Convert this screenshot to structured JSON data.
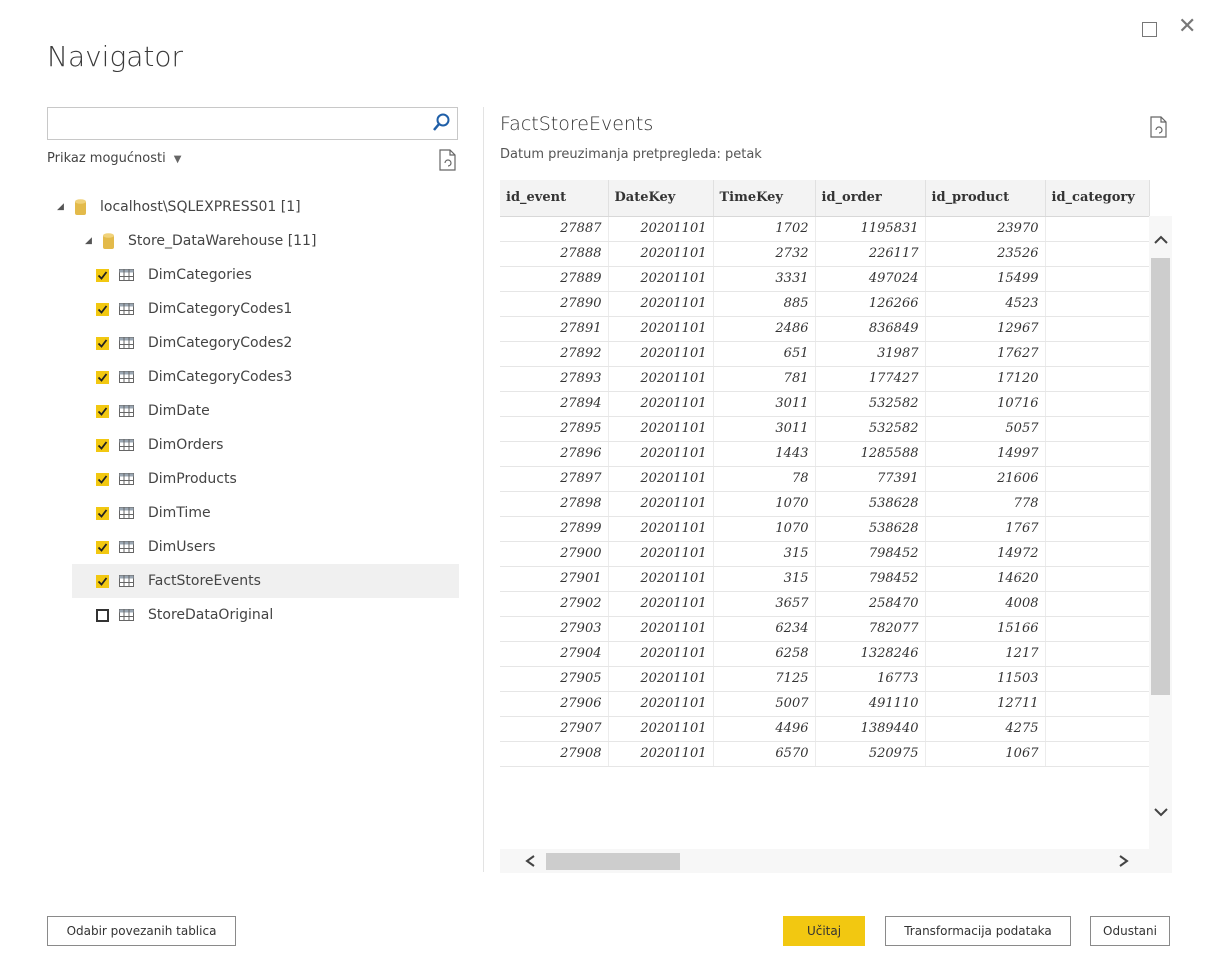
{
  "dialog": {
    "title": "Navigator"
  },
  "search": {
    "placeholder": ""
  },
  "left": {
    "display_options_label": "Prikaz mogućnosti",
    "server": "localhost\\SQLEXPRESS01 [1]",
    "database": "Store_DataWarehouse [11]",
    "items": [
      {
        "label": "DimCategories",
        "checked": true
      },
      {
        "label": "DimCategoryCodes1",
        "checked": true
      },
      {
        "label": "DimCategoryCodes2",
        "checked": true
      },
      {
        "label": "DimCategoryCodes3",
        "checked": true
      },
      {
        "label": "DimDate",
        "checked": true
      },
      {
        "label": "DimOrders",
        "checked": true
      },
      {
        "label": "DimProducts",
        "checked": true
      },
      {
        "label": "DimTime",
        "checked": true
      },
      {
        "label": "DimUsers",
        "checked": true
      },
      {
        "label": "FactStoreEvents",
        "checked": true,
        "selected": true
      },
      {
        "label": "StoreDataOriginal",
        "checked": false
      }
    ]
  },
  "preview": {
    "title": "FactStoreEvents",
    "subtitle": "Datum preuzimanja pretpregleda: petak",
    "columns": [
      "id_event",
      "DateKey",
      "TimeKey",
      "id_order",
      "id_product",
      "id_category"
    ],
    "rows": [
      [
        "27887",
        "20201101",
        "1702",
        "1195831",
        "23970",
        ""
      ],
      [
        "27888",
        "20201101",
        "2732",
        "226117",
        "23526",
        ""
      ],
      [
        "27889",
        "20201101",
        "3331",
        "497024",
        "15499",
        ""
      ],
      [
        "27890",
        "20201101",
        "885",
        "126266",
        "4523",
        ""
      ],
      [
        "27891",
        "20201101",
        "2486",
        "836849",
        "12967",
        ""
      ],
      [
        "27892",
        "20201101",
        "651",
        "31987",
        "17627",
        ""
      ],
      [
        "27893",
        "20201101",
        "781",
        "177427",
        "17120",
        ""
      ],
      [
        "27894",
        "20201101",
        "3011",
        "532582",
        "10716",
        ""
      ],
      [
        "27895",
        "20201101",
        "3011",
        "532582",
        "5057",
        ""
      ],
      [
        "27896",
        "20201101",
        "1443",
        "1285588",
        "14997",
        ""
      ],
      [
        "27897",
        "20201101",
        "78",
        "77391",
        "21606",
        ""
      ],
      [
        "27898",
        "20201101",
        "1070",
        "538628",
        "778",
        ""
      ],
      [
        "27899",
        "20201101",
        "1070",
        "538628",
        "1767",
        ""
      ],
      [
        "27900",
        "20201101",
        "315",
        "798452",
        "14972",
        ""
      ],
      [
        "27901",
        "20201101",
        "315",
        "798452",
        "14620",
        ""
      ],
      [
        "27902",
        "20201101",
        "3657",
        "258470",
        "4008",
        ""
      ],
      [
        "27903",
        "20201101",
        "6234",
        "782077",
        "15166",
        ""
      ],
      [
        "27904",
        "20201101",
        "6258",
        "1328246",
        "1217",
        ""
      ],
      [
        "27905",
        "20201101",
        "7125",
        "16773",
        "11503",
        ""
      ],
      [
        "27906",
        "20201101",
        "5007",
        "491110",
        "12711",
        ""
      ],
      [
        "27907",
        "20201101",
        "4496",
        "1389440",
        "4275",
        ""
      ],
      [
        "27908",
        "20201101",
        "6570",
        "520975",
        "1067",
        ""
      ]
    ]
  },
  "buttons": {
    "select_related": "Odabir povezanih tablica",
    "load": "Učitaj",
    "transform": "Transformacija podataka",
    "cancel": "Odustani"
  },
  "colors": {
    "accent": "#f2c811",
    "selected_row": "#f0f0f0"
  }
}
